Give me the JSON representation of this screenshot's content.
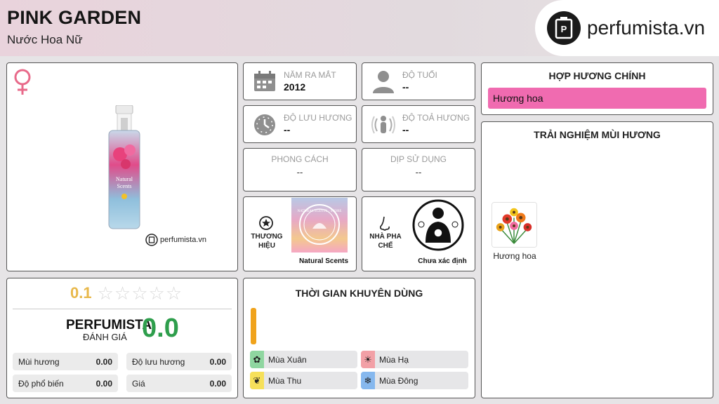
{
  "header": {
    "title": "PINK GARDEN",
    "subtitle": "Nước Hoa Nữ",
    "logo_text": "perfumista.vn"
  },
  "product": {
    "gender_icon": "female-icon",
    "watermark": "perfumista.vn"
  },
  "rating": {
    "user_score": "0.1",
    "stars": [
      "☆",
      "☆",
      "☆",
      "☆",
      "☆"
    ],
    "brand_label": "PERFUMISTA",
    "brand_sub": "ĐÁNH GIÁ",
    "brand_score": "0.0",
    "stats": [
      {
        "label": "Mùi hương",
        "value": "0.00"
      },
      {
        "label": "Độ lưu hương",
        "value": "0.00"
      },
      {
        "label": "Độ phổ biến",
        "value": "0.00"
      },
      {
        "label": "Giá",
        "value": "0.00"
      }
    ]
  },
  "info": {
    "release": {
      "label": "NĂM RA MẮT",
      "value": "2012"
    },
    "age": {
      "label": "ĐỘ TUỔI",
      "value": "--"
    },
    "longevity": {
      "label": "ĐỘ LƯU HƯƠNG",
      "value": "--"
    },
    "sillage": {
      "label": "ĐỘ TOẢ HƯƠNG",
      "value": "--"
    },
    "style": {
      "label": "PHONG CÁCH",
      "value": "--"
    },
    "occasion": {
      "label": "DỊP SỬ DỤNG",
      "value": "--"
    },
    "brand": {
      "label": "THƯƠNG HIỆU",
      "name": "Natural Scents",
      "logo_text": "NATURAL SCENTS · STORE"
    },
    "perfumer": {
      "label": "NHÀ PHA CHẾ",
      "name": "Chưa xác định"
    }
  },
  "seasons": {
    "title": "THỜI GIAN KHUYÊN DÙNG",
    "items": [
      {
        "label": "Mùa Xuân",
        "icon": "spring-flower-icon",
        "color": "#8fd6a0"
      },
      {
        "label": "Mùa Hạ",
        "icon": "sun-icon",
        "color": "#f2a0a6"
      },
      {
        "label": "Mùa Thu",
        "icon": "leaf-icon",
        "color": "#f6e05a"
      },
      {
        "label": "Mùa Đông",
        "icon": "snowflake-icon",
        "color": "#86b8ee"
      }
    ],
    "bar_color": "#f0a31c"
  },
  "accords": {
    "title": "HỢP HƯƠNG CHÍNH",
    "items": [
      {
        "label": "Hương hoa",
        "color": "#f06bb0"
      }
    ]
  },
  "experience": {
    "title": "TRẢI NGHIỆM MÙI HƯƠNG",
    "notes": [
      {
        "label": "Hương hoa"
      }
    ]
  }
}
